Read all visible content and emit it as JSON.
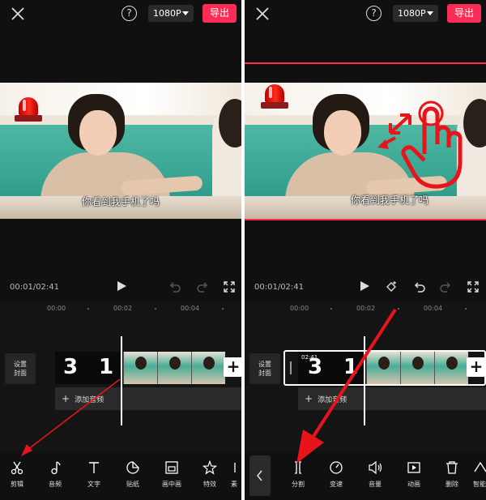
{
  "topbar": {
    "resolution": "1080P",
    "export_label": "导出",
    "help_label": "?"
  },
  "video": {
    "subtitle": "你看到我手机了吗"
  },
  "player": {
    "time": "00:01/02:41"
  },
  "timeline": {
    "ruler": [
      "00:00",
      "00:02",
      "00:04"
    ],
    "cover_label_1": "设置",
    "cover_label_2": "封面",
    "intro_digits": [
      "3",
      "1"
    ],
    "add_audio_label": "添加音频",
    "add_clip_label": "+",
    "selected_clip_time": "02:41"
  },
  "toolbar_left": [
    {
      "label": "剪辑",
      "icon": "scissors-icon"
    },
    {
      "label": "音频",
      "icon": "music-note-icon"
    },
    {
      "label": "文字",
      "icon": "text-icon"
    },
    {
      "label": "贴纸",
      "icon": "sticker-icon"
    },
    {
      "label": "画中画",
      "icon": "picture-in-picture-icon"
    },
    {
      "label": "特效",
      "icon": "effects-star-icon"
    },
    {
      "label": "素",
      "icon": "material-icon"
    }
  ],
  "toolbar_right": [
    {
      "label": "分割",
      "icon": "split-icon"
    },
    {
      "label": "变速",
      "icon": "speed-icon"
    },
    {
      "label": "音量",
      "icon": "volume-icon"
    },
    {
      "label": "动画",
      "icon": "animation-icon"
    },
    {
      "label": "删除",
      "icon": "delete-icon"
    },
    {
      "label": "智能",
      "icon": "smart-icon"
    }
  ],
  "colors": {
    "accent": "#fe2c55",
    "annotation": "#e8141c",
    "background": "#101010"
  }
}
